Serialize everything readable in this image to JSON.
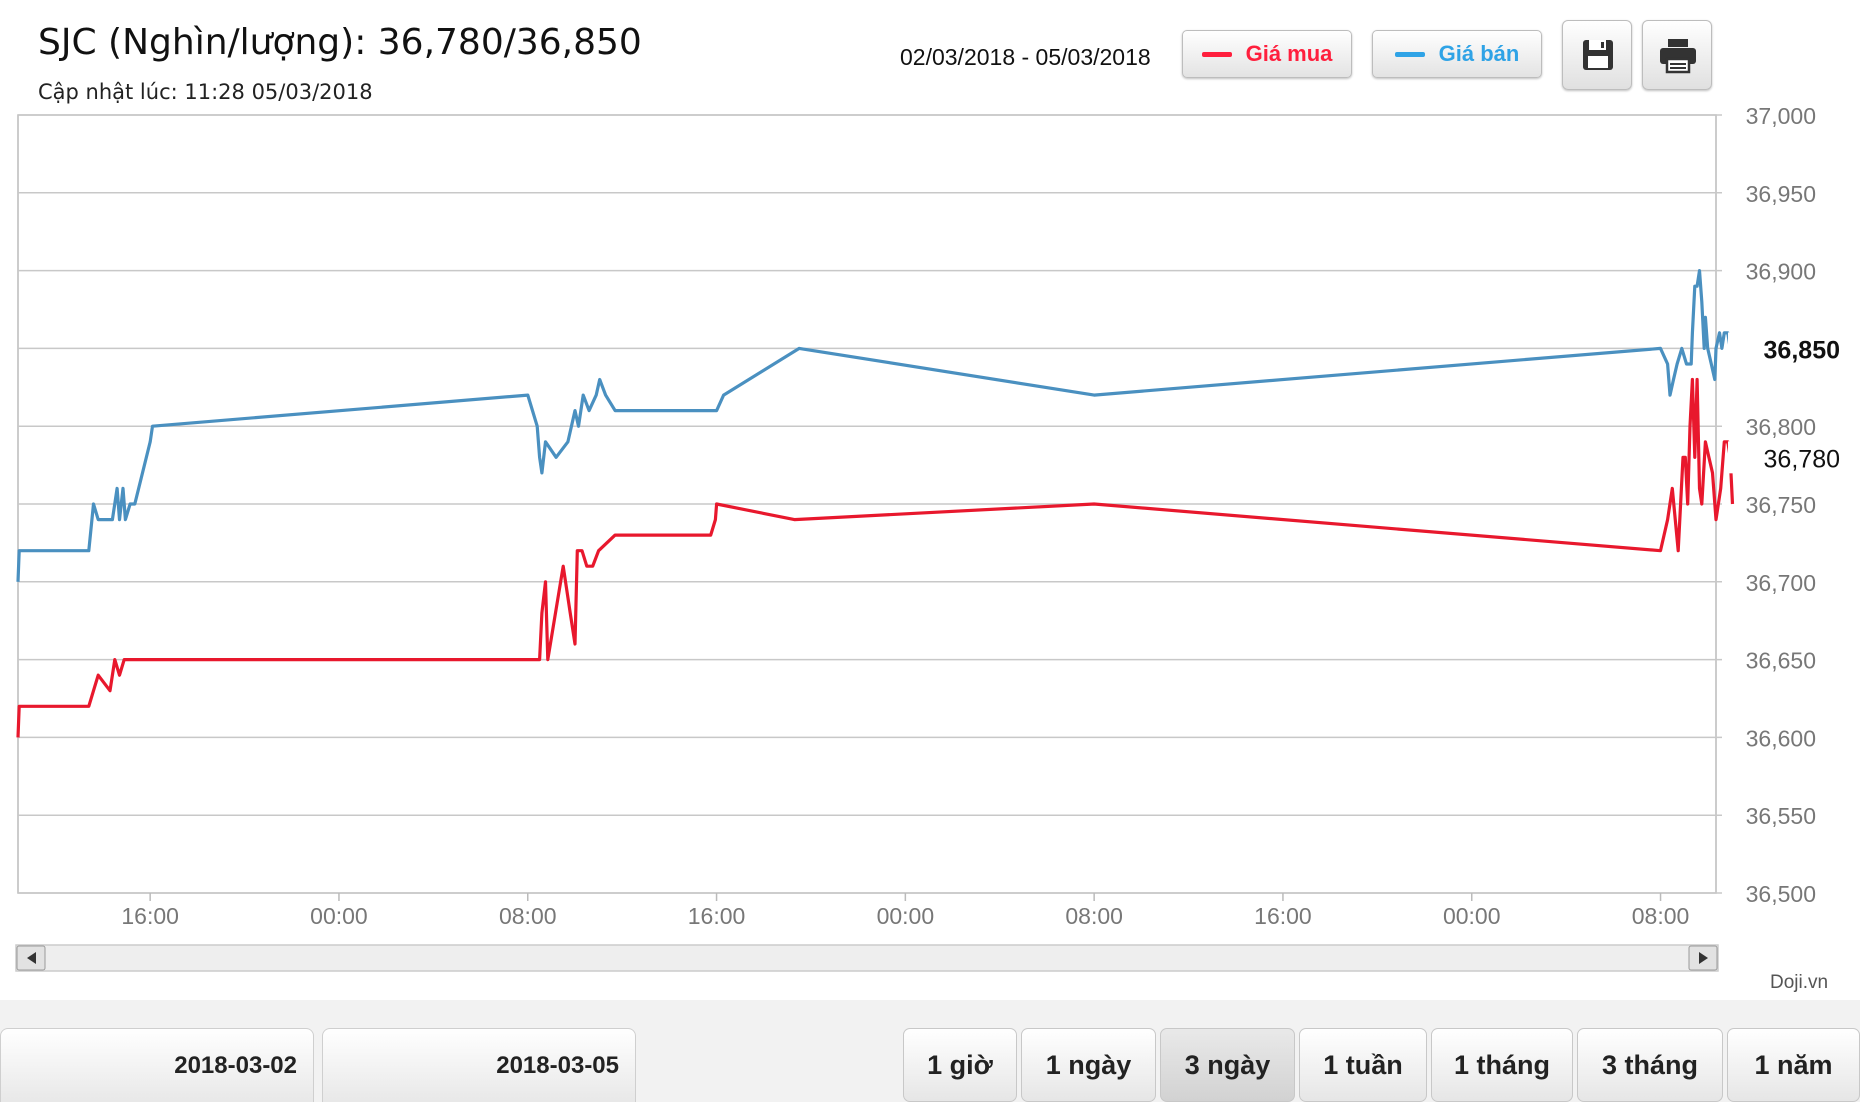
{
  "header": {
    "title": "SJC (Nghìn/lượng): 36,780/36,850",
    "updated": "Cập nhật lúc: 11:28 05/03/2018",
    "date_range": "02/03/2018 - 05/03/2018"
  },
  "legend": {
    "buy": {
      "label": "Giá mua",
      "color": "#ff1f3d"
    },
    "sell": {
      "label": "Giá bán",
      "color": "#2fa3e6"
    }
  },
  "toolbar": {
    "save_icon": "save-icon",
    "print_icon": "print-icon"
  },
  "watermark": "Doji.vn",
  "navigator": {
    "from": "2018-03-02",
    "to": "2018-03-05"
  },
  "range_buttons": [
    {
      "label": "1 giờ"
    },
    {
      "label": "1 ngày"
    },
    {
      "label": "3 ngày",
      "active": true
    },
    {
      "label": "1 tuần"
    },
    {
      "label": "1 tháng"
    },
    {
      "label": "3 tháng"
    },
    {
      "label": "1 năm"
    }
  ],
  "chart_data": {
    "type": "line",
    "title": "SJC (Nghìn/lượng): 36,780/36,850",
    "xlabel": "",
    "ylabel": "",
    "x_unit": "hours since 2018-03-02 00:00",
    "xlim": [
      10.4,
      82.35
    ],
    "ylim": [
      36500,
      37000
    ],
    "x_tick_labels": [
      "16:00",
      "00:00",
      "08:00",
      "16:00",
      "00:00",
      "08:00",
      "16:00",
      "00:00",
      "08:00"
    ],
    "x_ticks": [
      16,
      24,
      32,
      40,
      48,
      56,
      64,
      72,
      80
    ],
    "y_ticks": [
      36500,
      36550,
      36600,
      36650,
      36700,
      36750,
      36800,
      36850,
      36900,
      36950,
      37000
    ],
    "y_tick_labels": [
      "36,500",
      "36,550",
      "36,600",
      "36,650",
      "36,700",
      "36,750",
      "36,800",
      "36,850",
      "36,900",
      "36,950",
      "37,000"
    ],
    "current": {
      "sell": "36,850",
      "buy": "36,780"
    },
    "grid": true,
    "legend_position": "top-right",
    "series": [
      {
        "name": "Giá bán",
        "color": "#4a90c0",
        "points": [
          [
            10.4,
            36700
          ],
          [
            10.45,
            36720
          ],
          [
            13.4,
            36720
          ],
          [
            13.6,
            36750
          ],
          [
            13.8,
            36740
          ],
          [
            14.4,
            36740
          ],
          [
            14.6,
            36760
          ],
          [
            14.7,
            36740
          ],
          [
            14.85,
            36760
          ],
          [
            14.95,
            36740
          ],
          [
            15.15,
            36750
          ],
          [
            15.35,
            36750
          ],
          [
            16.0,
            36790
          ],
          [
            16.1,
            36800
          ],
          [
            32.0,
            36820
          ],
          [
            32.4,
            36800
          ],
          [
            32.5,
            36780
          ],
          [
            32.6,
            36770
          ],
          [
            32.75,
            36790
          ],
          [
            33.2,
            36780
          ],
          [
            33.7,
            36790
          ],
          [
            34.0,
            36810
          ],
          [
            34.15,
            36800
          ],
          [
            34.35,
            36820
          ],
          [
            34.6,
            36810
          ],
          [
            34.9,
            36820
          ],
          [
            35.05,
            36830
          ],
          [
            35.3,
            36820
          ],
          [
            35.7,
            36810
          ],
          [
            37.6,
            36810
          ],
          [
            37.8,
            36810
          ],
          [
            38.0,
            36810
          ],
          [
            40.0,
            36810
          ],
          [
            40.3,
            36820
          ],
          [
            43.5,
            36850
          ],
          [
            56.0,
            36820
          ],
          [
            80.0,
            36850
          ],
          [
            80.3,
            36840
          ],
          [
            80.4,
            36820
          ],
          [
            80.55,
            36830
          ],
          [
            80.7,
            36840
          ],
          [
            80.9,
            36850
          ],
          [
            81.1,
            36840
          ],
          [
            81.3,
            36840
          ],
          [
            81.35,
            36860
          ],
          [
            81.45,
            36890
          ],
          [
            81.55,
            36890
          ],
          [
            81.65,
            36900
          ],
          [
            81.75,
            36880
          ],
          [
            81.85,
            36850
          ],
          [
            81.9,
            36870
          ],
          [
            82.0,
            36850
          ],
          [
            82.15,
            36840
          ],
          [
            82.3,
            36830
          ],
          [
            82.35,
            36850
          ],
          [
            82.5,
            36860
          ],
          [
            82.6,
            36850
          ],
          [
            82.7,
            36860
          ],
          [
            82.85,
            36860
          ],
          [
            82.95,
            36850
          ]
        ]
      },
      {
        "name": "Giá mua",
        "color": "#e8182d",
        "points": [
          [
            10.4,
            36600
          ],
          [
            10.45,
            36620
          ],
          [
            13.4,
            36620
          ],
          [
            13.6,
            36630
          ],
          [
            13.8,
            36640
          ],
          [
            14.3,
            36630
          ],
          [
            14.5,
            36650
          ],
          [
            14.7,
            36640
          ],
          [
            14.9,
            36650
          ],
          [
            15.05,
            36650
          ],
          [
            16.0,
            36650
          ],
          [
            32.5,
            36650
          ],
          [
            32.6,
            36680
          ],
          [
            32.75,
            36700
          ],
          [
            32.85,
            36650
          ],
          [
            33.5,
            36710
          ],
          [
            33.8,
            36680
          ],
          [
            34.0,
            36660
          ],
          [
            34.1,
            36720
          ],
          [
            34.3,
            36720
          ],
          [
            34.5,
            36710
          ],
          [
            34.75,
            36710
          ],
          [
            35.0,
            36720
          ],
          [
            35.7,
            36730
          ],
          [
            37.6,
            36730
          ],
          [
            38.0,
            36730
          ],
          [
            39.75,
            36730
          ],
          [
            39.95,
            36740
          ],
          [
            40.0,
            36750
          ],
          [
            43.3,
            36740
          ],
          [
            56.0,
            36750
          ],
          [
            80.0,
            36720
          ],
          [
            80.3,
            36740
          ],
          [
            80.5,
            36760
          ],
          [
            80.75,
            36720
          ],
          [
            80.85,
            36750
          ],
          [
            80.95,
            36780
          ],
          [
            81.05,
            36780
          ],
          [
            81.15,
            36750
          ],
          [
            81.25,
            36800
          ],
          [
            81.35,
            36830
          ],
          [
            81.45,
            36780
          ],
          [
            81.55,
            36830
          ],
          [
            81.65,
            36760
          ],
          [
            81.75,
            36750
          ],
          [
            81.9,
            36790
          ],
          [
            82.05,
            36780
          ],
          [
            82.2,
            36770
          ],
          [
            82.35,
            36740
          ],
          [
            82.55,
            36760
          ],
          [
            82.7,
            36790
          ],
          [
            82.85,
            36790
          ],
          [
            82.95,
            36780
          ],
          [
            83.05,
            36750
          ]
        ]
      }
    ]
  }
}
